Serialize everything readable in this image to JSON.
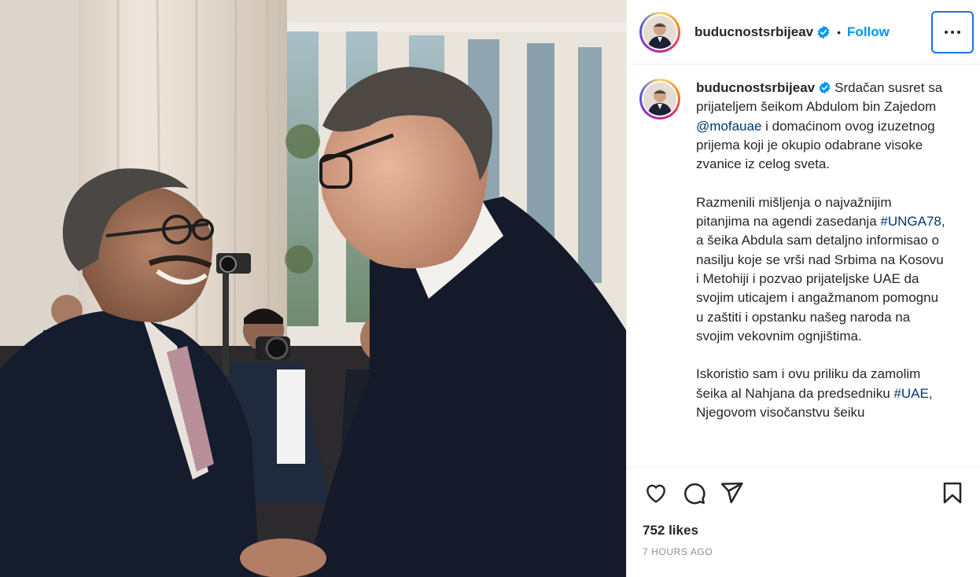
{
  "post": {
    "username": "buducnostsrbijeav",
    "follow_label": "Follow",
    "separator": "•",
    "caption": {
      "username": "buducnostsrbijeav",
      "para1_a": "Srdačan susret sa prijateljem šeikom Abdulom bin Zajedom ",
      "para1_mention": "@mofauae",
      "para1_b": " i domaćinom ovog izuzetnog prijema koji je okupio odabrane visoke zvanice iz celog sveta.",
      "para2_a": "Razmenili mišljenja o najvažnijim pitanjima na agendi zasedanja ",
      "para2_tag": "#UNGA78",
      "para2_b": ", a šeika Abdula sam detaljno informisao o nasilju koje se vrši nad Srbima na Kosovu i Metohiji i pozvao prijateljske UAE da svojim uticajem i angažmanom pomognu u zaštiti i opstanku našeg naroda na svojim vekovnim ognjištima.",
      "para3_a": "Iskoristio sam i ovu priliku da zamolim šeika al Nahjana da predsedniku ",
      "para3_tag": "#UAE",
      "para3_b": ", Njegovom visočanstvu šeiku"
    },
    "likes": "752 likes",
    "time": "7 HOURS AGO"
  },
  "icons": {
    "verified": "verified-badge-icon",
    "more": "more-options-icon",
    "like": "heart-icon",
    "comment": "comment-icon",
    "share": "send-icon",
    "save": "bookmark-icon"
  },
  "colors": {
    "accent": "#0095f6",
    "link": "#00376b",
    "muted": "#8e8e8e",
    "focus_ring": "#1b73e8"
  }
}
